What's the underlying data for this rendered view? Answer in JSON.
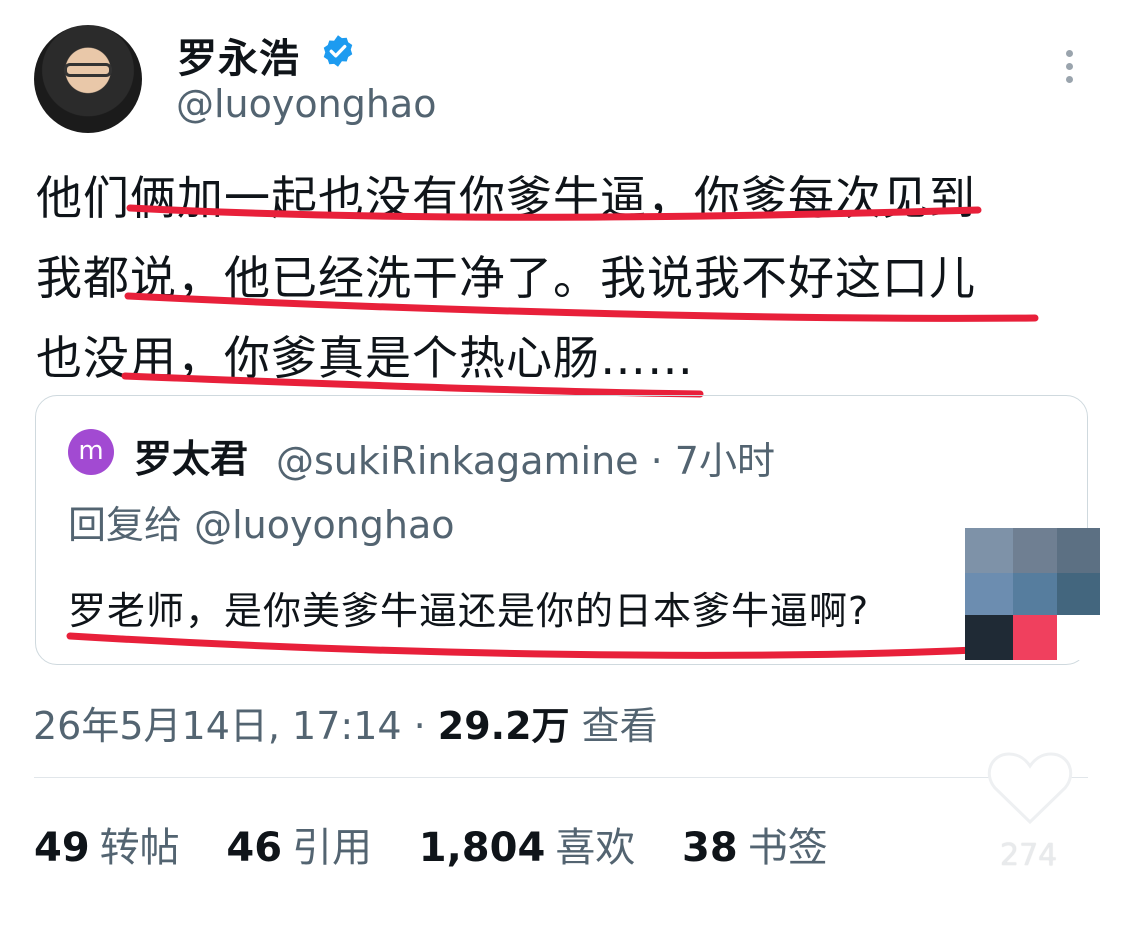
{
  "author": {
    "name": "罗永浩",
    "handle": "@luoyonghao"
  },
  "tweet": {
    "lines": [
      "他们俩加一起也没有你爹牛逼，你爹每次见到",
      "我都说，他已经洗干净了。我说我不好这口儿",
      "也没用，你爹真是个热心肠……"
    ]
  },
  "quoted": {
    "avatar_letter": "m",
    "name": "罗太君",
    "meta": "@sukiRinkagamine · 7小时",
    "reply_to": "回复给 @luoyonghao",
    "text": "罗老师，是你美爹牛逼还是你的日本爹牛逼啊?"
  },
  "timestamp": {
    "date": "26年5月14日, 17:14 · ",
    "views": "29.2万",
    "views_label": " 查看"
  },
  "stats": [
    {
      "count": "49",
      "label": "转帖"
    },
    {
      "count": "46",
      "label": "引用"
    },
    {
      "count": "1,804",
      "label": "喜欢"
    },
    {
      "count": "38",
      "label": "书签"
    }
  ],
  "overlay_like_count": "274",
  "colors": {
    "verified": "#1d9bf0",
    "annotation_red": "#e8203a",
    "secondary_text": "#536471"
  },
  "icons": [
    "verified-badge-icon",
    "more-options-icon",
    "heart-icon"
  ]
}
